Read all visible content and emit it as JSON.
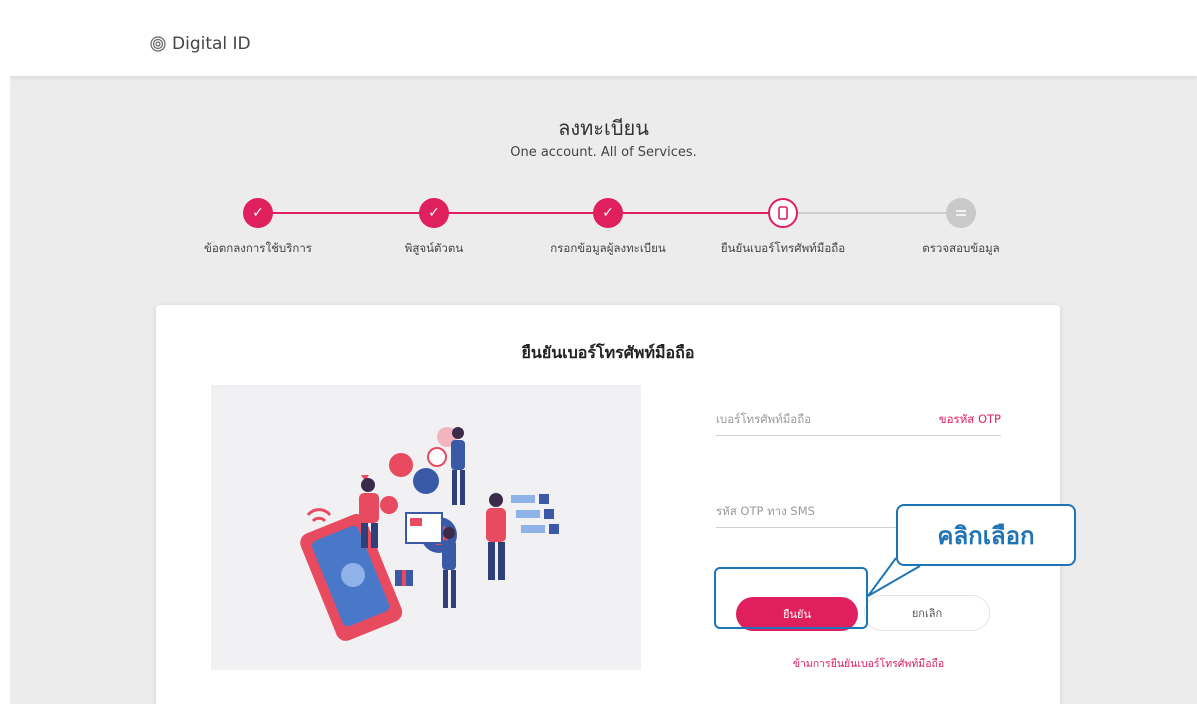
{
  "header": {
    "brand": "Digital ID"
  },
  "page": {
    "title": "ลงทะเบียน",
    "subtitle": "One account. All of Services."
  },
  "stepper": {
    "steps": [
      {
        "label": "ข้อตกลงการใช้บริการ",
        "status": "done"
      },
      {
        "label": "พิสูจน์ตัวตน",
        "status": "done"
      },
      {
        "label": "กรอกข้อมูลผู้ลงทะเบียน",
        "status": "done"
      },
      {
        "label": "ยืนยันเบอร์โทรศัพท์มือถือ",
        "status": "current"
      },
      {
        "label": "ตรวจสอบข้อมูล",
        "status": "todo"
      }
    ]
  },
  "card": {
    "title": "ยืนยันเบอร์โทรศัพท์มือถือ",
    "phone_placeholder": "เบอร์โทรศัพท์มือถือ",
    "request_otp": "ขอรหัส OTP",
    "otp_placeholder": "รหัส OTP ทาง SMS",
    "confirm_label": "ยืนยัน",
    "cancel_label": "ยกเลิก",
    "skip_link": "ข้ามการยืนยันเบอร์โทรศัพท์มือถือ"
  },
  "annotation": {
    "callout": "คลิกเลือก"
  },
  "colors": {
    "accent": "#e01f5e",
    "callout": "#1f74b6",
    "inactive": "#c9c9c9"
  },
  "icons": {
    "done": "check-icon",
    "current": "mobile-phone-icon",
    "todo": "list-icon"
  }
}
